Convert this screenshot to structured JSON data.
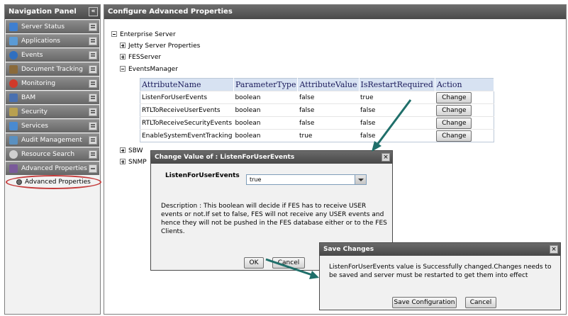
{
  "nav": {
    "title": "Navigation Panel",
    "collapse_glyph": "«",
    "items": [
      {
        "label": "Server Status",
        "icon": "server-status-icon",
        "color": "#3f7fd0"
      },
      {
        "label": "Applications",
        "icon": "applications-icon",
        "color": "#5b9bd5"
      },
      {
        "label": "Events",
        "icon": "events-icon",
        "color": "#2f6fc0"
      },
      {
        "label": "Document Tracking",
        "icon": "document-tracking-icon",
        "color": "#8a6a3a"
      },
      {
        "label": "Monitoring",
        "icon": "monitoring-icon",
        "color": "#d03a2a"
      },
      {
        "label": "BAM",
        "icon": "bam-icon",
        "color": "#4a70b0"
      },
      {
        "label": "Security",
        "icon": "security-icon",
        "color": "#b8a050"
      },
      {
        "label": "Services",
        "icon": "services-icon",
        "color": "#4a8ad0"
      },
      {
        "label": "Audit Management",
        "icon": "audit-management-icon",
        "color": "#5a90c0"
      },
      {
        "label": "Resource Search",
        "icon": "resource-search-icon",
        "color": "#6a6a6a"
      },
      {
        "label": "Advanced Properties",
        "icon": "advanced-properties-icon",
        "color": "#7a5a9a"
      }
    ],
    "sub_item": "Advanced Properties"
  },
  "main": {
    "title": "Configure Advanced Properties",
    "tree": {
      "root": "Enterprise Server",
      "jetty": "Jetty Server Properties",
      "fes": "FESServer",
      "events": "EventsManager",
      "sbw": "SBW",
      "snmp": "SNMP"
    },
    "table": {
      "headers": [
        "AttributeName",
        "ParameterType",
        "AttributeValue",
        "IsRestartRequired",
        "Action"
      ],
      "rows": [
        [
          "ListenForUserEvents",
          "boolean",
          "false",
          "true",
          "Change"
        ],
        [
          "RTLToReceiveUserEvents",
          "boolean",
          "false",
          "false",
          "Change"
        ],
        [
          "RTLToReceiveSecurityEvents",
          "boolean",
          "false",
          "false",
          "Change"
        ],
        [
          "EnableSystemEventTracking",
          "boolean",
          "true",
          "false",
          "Change"
        ]
      ]
    }
  },
  "change_dialog": {
    "title": "Change Value of : ListenForUserEvents",
    "field_label": "ListenForUserEvents",
    "field_value": "true",
    "description": "Description : This boolean will decide if FES has to receive USER events or not.If set to false, FES will not receive any USER events and hence they will not be pushed in the FES database either or to the FES Clients.",
    "ok_label": "OK",
    "cancel_label": "Cancel"
  },
  "save_dialog": {
    "title": "Save Changes",
    "message": "ListenForUserEvents value is Successfully changed.Changes needs to be saved and server must be restarted to get them into effect",
    "save_label": "Save Configuration",
    "cancel_label": "Cancel"
  },
  "colors": {
    "header": "#4a4a4a",
    "table_header": "#d7e2f2",
    "highlight_ring": "#c43b3b",
    "arrow": "#1f6f6a"
  }
}
